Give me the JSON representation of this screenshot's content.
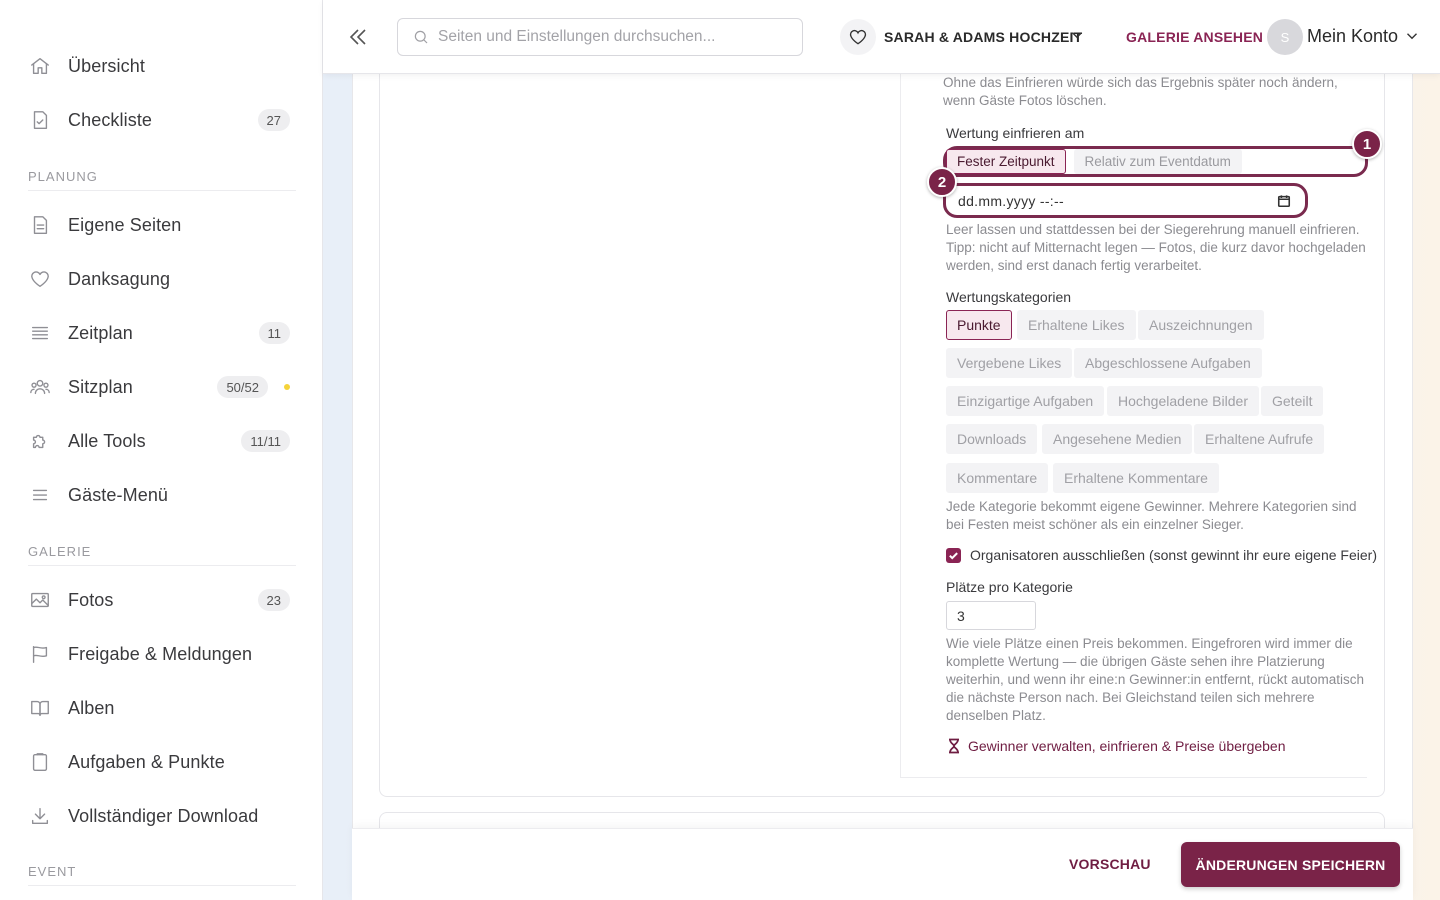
{
  "sidebar": {
    "items": [
      {
        "label": "Übersicht",
        "icon": "home-icon"
      },
      {
        "label": "Checkliste",
        "icon": "checklist-icon",
        "badge": "27"
      },
      {
        "label": "Eigene Seiten",
        "icon": "page-icon"
      },
      {
        "label": "Danksagung",
        "icon": "heart-icon"
      },
      {
        "label": "Zeitplan",
        "icon": "schedule-icon",
        "badge": "11"
      },
      {
        "label": "Sitzplan",
        "icon": "people-icon",
        "badge": "50/52"
      },
      {
        "label": "Alle Tools",
        "icon": "puzzle-icon",
        "badge": "11/11"
      },
      {
        "label": "Gäste-Menü",
        "icon": "menu-icon"
      },
      {
        "label": "Fotos",
        "icon": "photo-icon",
        "badge": "23"
      },
      {
        "label": "Freigabe & Meldungen",
        "icon": "flag-icon"
      },
      {
        "label": "Alben",
        "icon": "book-icon"
      },
      {
        "label": "Aufgaben & Punkte",
        "icon": "clipboard-icon"
      },
      {
        "label": "Vollständiger Download",
        "icon": "download-icon"
      }
    ],
    "sections": [
      "PLANUNG",
      "GALERIE",
      "EVENT"
    ]
  },
  "topbar": {
    "search_placeholder": "Seiten und Einstellungen durchsuchen...",
    "event_name": "SARAH & ADAMS HOCHZEIT",
    "gallery_link": "GALERIE ANSEHEN",
    "avatar_initial": "S",
    "account_label": "Mein Konto"
  },
  "panel": {
    "freeze_help": "Ohne das Einfrieren würde sich das Ergebnis später noch ändern, wenn Gäste Fotos löschen.",
    "freeze_label": "Wertung einfrieren am",
    "freeze_options": [
      "Fester Zeitpunkt",
      "Relativ zum Eventdatum"
    ],
    "date_value": "dd.mm.yyyy --:--",
    "date_help": "Leer lassen und stattdessen bei der Siegerehrung manuell einfrieren. Tipp: nicht auf Mitternacht legen — Fotos, die kurz davor hochgeladen werden, sind erst danach fertig verarbeitet.",
    "categories_label": "Wertungskategorien",
    "categories": [
      "Punkte",
      "Erhaltene Likes",
      "Auszeichnungen",
      "Vergebene Likes",
      "Abgeschlossene Aufgaben",
      "Einzigartige Aufgaben",
      "Hochgeladene Bilder",
      "Geteilt",
      "Downloads",
      "Angesehene Medien",
      "Erhaltene Aufrufe",
      "Kommentare",
      "Erhaltene Kommentare"
    ],
    "categories_help": "Jede Kategorie bekommt eigene Gewinner. Mehrere Kategorien sind bei Festen meist schöner als ein einzelner Sieger.",
    "exclude_label": "Organisatoren ausschließen (sonst gewinnt ihr eure eigene Feier)",
    "places_label": "Plätze pro Kategorie",
    "places_value": "3",
    "places_help": "Wie viele Plätze einen Preis bekommen. Eingefroren wird immer die komplette Wertung — die übrigen Gäste sehen ihre Platzierung weiterhin, und wenn ihr eine:n Gewinner:in entfernt, rückt automatisch die nächste Person nach. Bei Gleichstand teilen sich mehrere denselben Platz.",
    "winner_link": "Gewinner verwalten, einfrieren & Preise übergeben",
    "callouts": [
      "1",
      "2"
    ]
  },
  "footer": {
    "preview": "VORSCHAU",
    "save": "ÄNDERUNGEN SPEICHERN"
  },
  "colors": {
    "accent": "#7a2348",
    "accent_light": "#f7e8ee",
    "status_dot": "#f5d33a"
  }
}
